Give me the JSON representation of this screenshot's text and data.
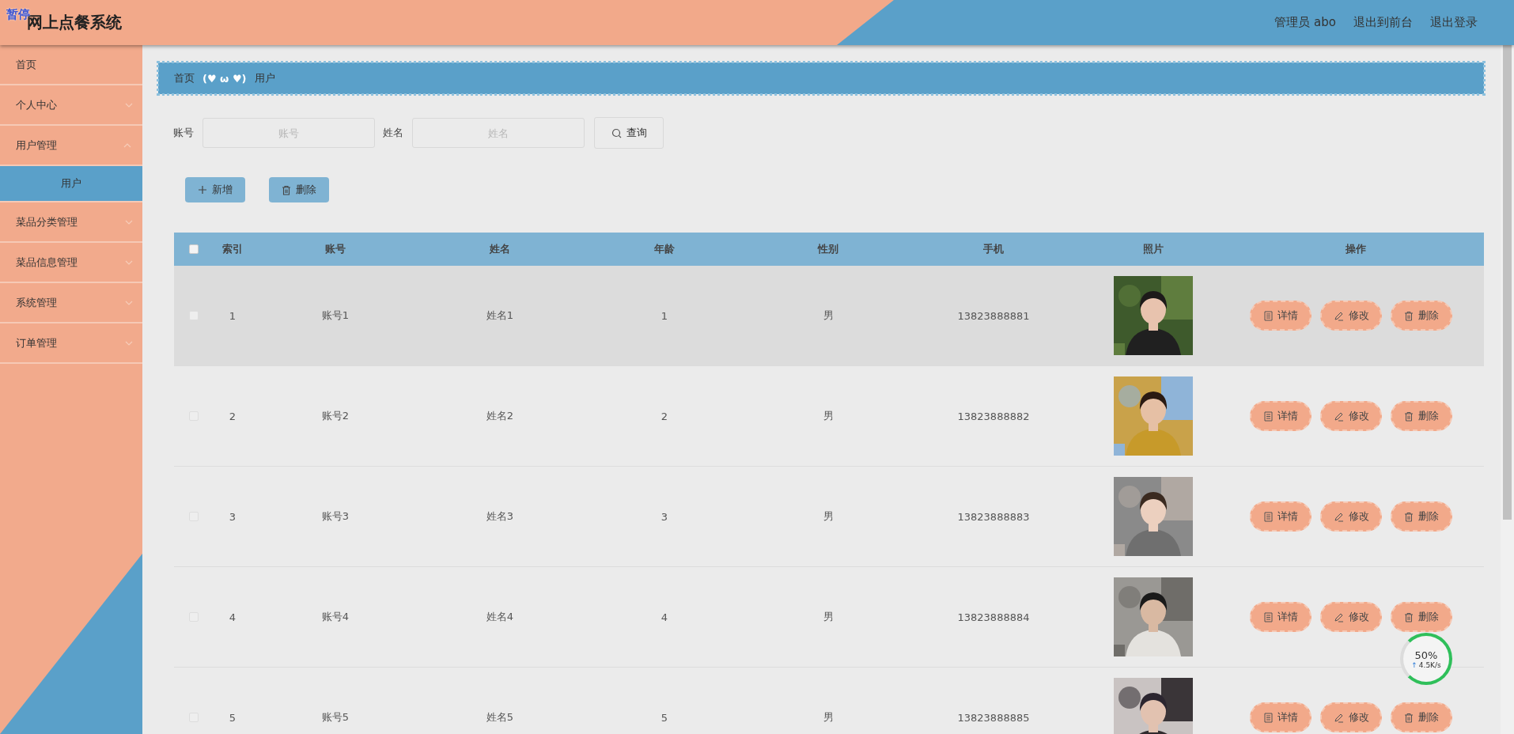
{
  "recorder_badge": "暂停",
  "header": {
    "title": "网上点餐系统",
    "links": [
      "管理员 abo",
      "退出到前台",
      "退出登录"
    ]
  },
  "sidebar": {
    "items": [
      {
        "label": "首页",
        "kind": "link"
      },
      {
        "label": "个人中心",
        "kind": "submenu",
        "expanded": false
      },
      {
        "label": "用户管理",
        "kind": "submenu",
        "expanded": true,
        "children": [
          {
            "label": "用户",
            "selected": true
          }
        ]
      },
      {
        "label": "菜品分类管理",
        "kind": "submenu",
        "expanded": false
      },
      {
        "label": "菜品信息管理",
        "kind": "submenu",
        "expanded": false
      },
      {
        "label": "系统管理",
        "kind": "submenu",
        "expanded": false
      },
      {
        "label": "订单管理",
        "kind": "submenu",
        "expanded": false
      }
    ]
  },
  "breadcrumb": {
    "items": [
      "首页",
      "用户"
    ],
    "separator": "(♥ ω ♥)"
  },
  "search": {
    "fields": [
      {
        "label": "账号",
        "placeholder": "账号"
      },
      {
        "label": "姓名",
        "placeholder": "姓名"
      }
    ],
    "button": "查询"
  },
  "toolbar": [
    {
      "label": "新增",
      "kind": "add"
    },
    {
      "label": "删除",
      "kind": "delete"
    }
  ],
  "table": {
    "all_selected": false,
    "columns": [
      "索引",
      "账号",
      "姓名",
      "年龄",
      "性别",
      "手机",
      "照片",
      "操作"
    ],
    "rows": [
      {
        "selected": false,
        "hovered": true,
        "cells": [
          "1",
          "账号1",
          "姓名1",
          "1",
          "男",
          "13823888881"
        ],
        "photo": {
          "kind": "picture"
        },
        "actions": [
          {
            "label": "详情",
            "kind": "detail"
          },
          {
            "label": "修改",
            "kind": "edit"
          },
          {
            "label": "删除",
            "kind": "delete"
          }
        ]
      },
      {
        "selected": false,
        "hovered": false,
        "cells": [
          "2",
          "账号2",
          "姓名2",
          "2",
          "男",
          "13823888882"
        ],
        "photo": {
          "kind": "picture"
        },
        "actions": [
          {
            "label": "详情",
            "kind": "detail"
          },
          {
            "label": "修改",
            "kind": "edit"
          },
          {
            "label": "删除",
            "kind": "delete"
          }
        ]
      },
      {
        "selected": false,
        "hovered": false,
        "cells": [
          "3",
          "账号3",
          "姓名3",
          "3",
          "男",
          "13823888883"
        ],
        "photo": {
          "kind": "picture"
        },
        "actions": [
          {
            "label": "详情",
            "kind": "detail"
          },
          {
            "label": "修改",
            "kind": "edit"
          },
          {
            "label": "删除",
            "kind": "delete"
          }
        ]
      },
      {
        "selected": false,
        "hovered": false,
        "cells": [
          "4",
          "账号4",
          "姓名4",
          "4",
          "男",
          "13823888884"
        ],
        "photo": {
          "kind": "picture"
        },
        "actions": [
          {
            "label": "详情",
            "kind": "detail"
          },
          {
            "label": "修改",
            "kind": "edit"
          },
          {
            "label": "删除",
            "kind": "delete"
          }
        ]
      },
      {
        "selected": false,
        "hovered": false,
        "cells": [
          "5",
          "账号5",
          "姓名5",
          "5",
          "男",
          "13823888885"
        ],
        "photo": {
          "kind": "picture"
        },
        "actions": [
          {
            "label": "详情",
            "kind": "detail"
          },
          {
            "label": "修改",
            "kind": "edit"
          },
          {
            "label": "删除",
            "kind": "delete"
          }
        ]
      }
    ]
  },
  "network_widget": {
    "percent": "50%",
    "arrow": "↑",
    "speed": "4.5K/s"
  }
}
